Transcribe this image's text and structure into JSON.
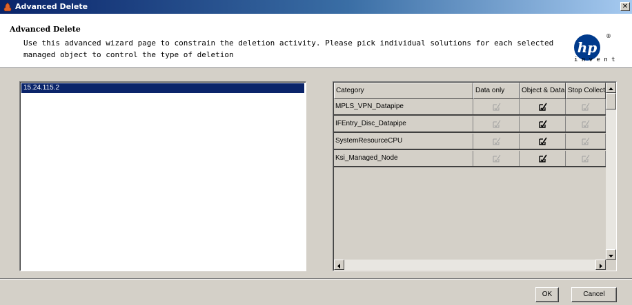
{
  "window": {
    "title": "Advanced Delete",
    "close_glyph": "✕"
  },
  "header": {
    "title": "Advanced Delete",
    "description": "Use this advanced wizard page to constrain the deletion activity. Please pick individual solutions for each selected managed object to control the type of deletion"
  },
  "logo": {
    "mark": "hp",
    "registered": "®",
    "tagline": "i n v e n t"
  },
  "objects": {
    "items": [
      "15.24.115.2"
    ],
    "selected_index": 0
  },
  "table": {
    "columns": [
      "Category",
      "Data only",
      "Object & Data",
      "Stop Collect"
    ],
    "rows": [
      {
        "category": "MPLS_VPN_Datapipe",
        "data_only": true,
        "object_data": true,
        "stop_collect": true,
        "enabled": [
          false,
          true,
          false
        ]
      },
      {
        "category": "IFEntry_Disc_Datapipe",
        "data_only": true,
        "object_data": true,
        "stop_collect": true,
        "enabled": [
          false,
          true,
          false
        ]
      },
      {
        "category": "SystemResourceCPU",
        "data_only": true,
        "object_data": true,
        "stop_collect": true,
        "enabled": [
          false,
          true,
          false
        ]
      },
      {
        "category": "Ksi_Managed_Node",
        "data_only": true,
        "object_data": true,
        "stop_collect": true,
        "enabled": [
          false,
          true,
          false
        ]
      }
    ]
  },
  "icons": {
    "app": "app-icon",
    "checkbox": "checkmark-icon"
  },
  "buttons": {
    "ok": "OK",
    "cancel": "Cancel"
  }
}
